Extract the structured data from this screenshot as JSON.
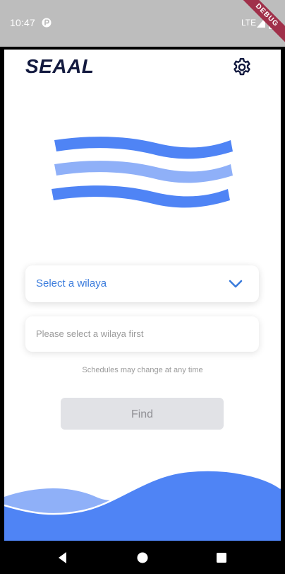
{
  "status_bar": {
    "time": "10:47",
    "network": "LTE",
    "debug_banner": "DEBUG"
  },
  "header": {
    "title": "SEAAL",
    "settings_icon": "gear-icon"
  },
  "form": {
    "wilaya_select_label": "Select a wilaya",
    "wilaya_select_icon": "chevron-down-icon",
    "second_field_label": "Please select a wilaya first",
    "note": "Schedules may change at any time",
    "find_button_label": "Find"
  },
  "colors": {
    "brand_dark": "#131a3f",
    "accent_blue": "#4f84f5",
    "light_blue": "#8fb0f8",
    "wilaya_text": "#3a7bdc",
    "disabled_button_bg": "#e1e2e6",
    "disabled_button_text": "#8f8f94",
    "status_bar_bg": "#bdbdbd"
  },
  "navigation": {
    "back_icon": "back-triangle-icon",
    "home_icon": "home-circle-icon",
    "recent_icon": "recent-square-icon"
  }
}
